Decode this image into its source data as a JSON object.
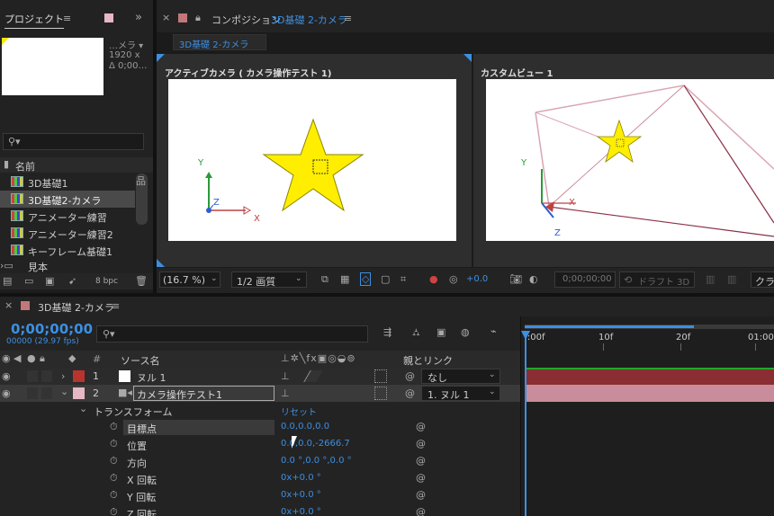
{
  "project_panel": {
    "tab_label": "プロジェクト",
    "info_name": "…メラ ▾",
    "info_size": "1920 x",
    "info_dur": "Δ 0;00…",
    "name_header": "名前",
    "items": [
      {
        "label": "3D基礎1"
      },
      {
        "label": "3D基礎2-カメラ"
      },
      {
        "label": "アニメーター練習"
      },
      {
        "label": "アニメーター練習2"
      },
      {
        "label": "キーフレーム基礎1"
      },
      {
        "label": "見本"
      }
    ],
    "bpc": "8 bpc"
  },
  "comp_panel": {
    "tab_prefix": "コンポジション",
    "tab_name": "3D基礎 2-カメラ",
    "breadcrumb": "3D基礎 2-カメラ",
    "left_view_title": "アクティブカメラ ( カメラ操作テスト 1)",
    "right_view_title": "カスタムビュー 1",
    "axis_y": "Y",
    "axis_x": "X",
    "axis_z": "Z",
    "zoom": "(16.7 %)",
    "quality": "1/2 画質",
    "exposure": "+0.0",
    "timecode": "0;00;00;00",
    "draft": "ドラフト 3D",
    "trailing": "クラ"
  },
  "timeline": {
    "tab_label": "3D基礎 2-カメラ",
    "timecode": "0;00;00;00",
    "fps": "00000 (29.97 fps)",
    "col_num": "#",
    "col_source": "ソース名",
    "col_parent": "親とリンク",
    "ruler_labels": [
      "):00f",
      "10f",
      "20f",
      "01:00"
    ],
    "layers": [
      {
        "num": "1",
        "name": "ヌル 1",
        "color": "#b8342f",
        "parent": "なし"
      },
      {
        "num": "2",
        "name": "カメラ操作テスト1",
        "color": "#e6b7c4",
        "parent": "1. ヌル 1"
      }
    ],
    "transform_label": "トランスフォーム",
    "reset_label": "リセット",
    "props": [
      {
        "name": "目標点",
        "value": "0.0,0.0,0.0"
      },
      {
        "name": "位置",
        "value": "0.0,0.0,-2666.7"
      },
      {
        "name": "方向",
        "value": "0.0 °,0.0 °,0.0 °"
      },
      {
        "name": "X 回転",
        "value": "0x+0.0 °"
      },
      {
        "name": "Y 回転",
        "value": "0x+0.0 °"
      },
      {
        "name": "Z 回転",
        "value": "0x+0.0 °"
      }
    ]
  },
  "colors": {
    "accent": "#3d8fe0",
    "star": "#ffee00",
    "null_bar": "#8a2e33",
    "camera_bar": "#c98c9a"
  }
}
